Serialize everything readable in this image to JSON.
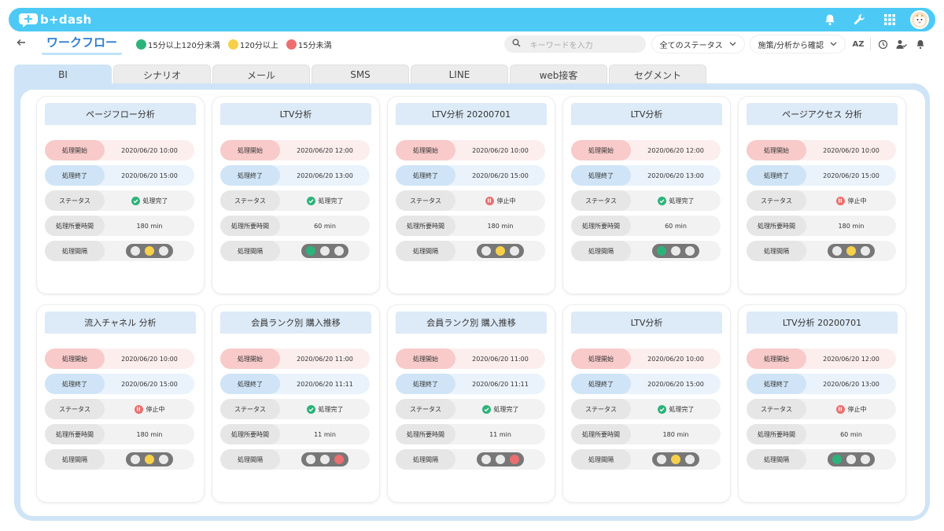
{
  "app": {
    "logo_text": "b+dash"
  },
  "header_icons": [
    "bell-icon",
    "wrench-icon",
    "apps-grid-icon",
    "user-avatar"
  ],
  "subbar": {
    "back_icon": "arrow-left-icon",
    "title": "ワークフロー",
    "legend": [
      {
        "label": "15分以上120分未満",
        "color": "#2db37a"
      },
      {
        "label": "120分以上",
        "color": "#f7d04a"
      },
      {
        "label": "15分未満",
        "color": "#ec6e6e"
      }
    ],
    "search_placeholder": "キーワードを入力",
    "status_filter": "全てのステータス",
    "mode_filter": "施策/分析から確認",
    "tool_icons": [
      "sort-az-icon",
      "history-icon",
      "user-check-icon",
      "bell-icon"
    ]
  },
  "tabs": [
    "BI",
    "シナリオ",
    "メール",
    "SMS",
    "LINE",
    "web接客",
    "セグメント"
  ],
  "active_tab": "BI",
  "labels": {
    "start": "処理開始",
    "end": "処理終了",
    "status": "ステータス",
    "duration": "処理所要時間",
    "interval": "処理間隔"
  },
  "colors": {
    "green": "#2db37a",
    "yellow": "#f7d04a",
    "red": "#ec6e6e",
    "off": "#eaeaea"
  },
  "cards": [
    {
      "title": "ページフロー分析",
      "start": "2020/06/20 10:00",
      "end": "2020/06/20 15:00",
      "status": "処理完了",
      "status_type": "done",
      "duration": "180 min",
      "light": "yellow"
    },
    {
      "title": "LTV分析",
      "start": "2020/06/20 12:00",
      "end": "2020/06/20 13:00",
      "status": "処理完了",
      "status_type": "done",
      "duration": "60 min",
      "light": "green"
    },
    {
      "title": "LTV分析 20200701",
      "start": "2020/06/20 10:00",
      "end": "2020/06/20 15:00",
      "status": "停止中",
      "status_type": "stopped",
      "duration": "180 min",
      "light": "yellow"
    },
    {
      "title": "LTV分析",
      "start": "2020/06/20 12:00",
      "end": "2020/06/20 13:00",
      "status": "処理完了",
      "status_type": "done",
      "duration": "60 min",
      "light": "green"
    },
    {
      "title": "ページアクセス 分析",
      "start": "2020/06/20 10:00",
      "end": "2020/06/20 15:00",
      "status": "停止中",
      "status_type": "stopped",
      "duration": "180 min",
      "light": "yellow"
    },
    {
      "title": "流入チャネル 分析",
      "start": "2020/06/20 10:00",
      "end": "2020/06/20 15:00",
      "status": "停止中",
      "status_type": "stopped",
      "duration": "180 min",
      "light": "yellow"
    },
    {
      "title": "会員ランク別 購入推移",
      "start": "2020/06/20 11:00",
      "end": "2020/06/20 11:11",
      "status": "処理完了",
      "status_type": "done",
      "duration": "11 min",
      "light": "red"
    },
    {
      "title": "会員ランク別 購入推移",
      "start": "2020/06/20 11:00",
      "end": "2020/06/20 11:11",
      "status": "処理完了",
      "status_type": "done",
      "duration": "11 min",
      "light": "red"
    },
    {
      "title": "LTV分析",
      "start": "2020/06/20 10:00",
      "end": "2020/06/20 15:00",
      "status": "処理完了",
      "status_type": "done",
      "duration": "180 min",
      "light": "yellow"
    },
    {
      "title": "LTV分析 20200701",
      "start": "2020/06/20 12:00",
      "end": "2020/06/20 13:00",
      "status": "停止中",
      "status_type": "stopped",
      "duration": "60 min",
      "light": "green"
    }
  ]
}
